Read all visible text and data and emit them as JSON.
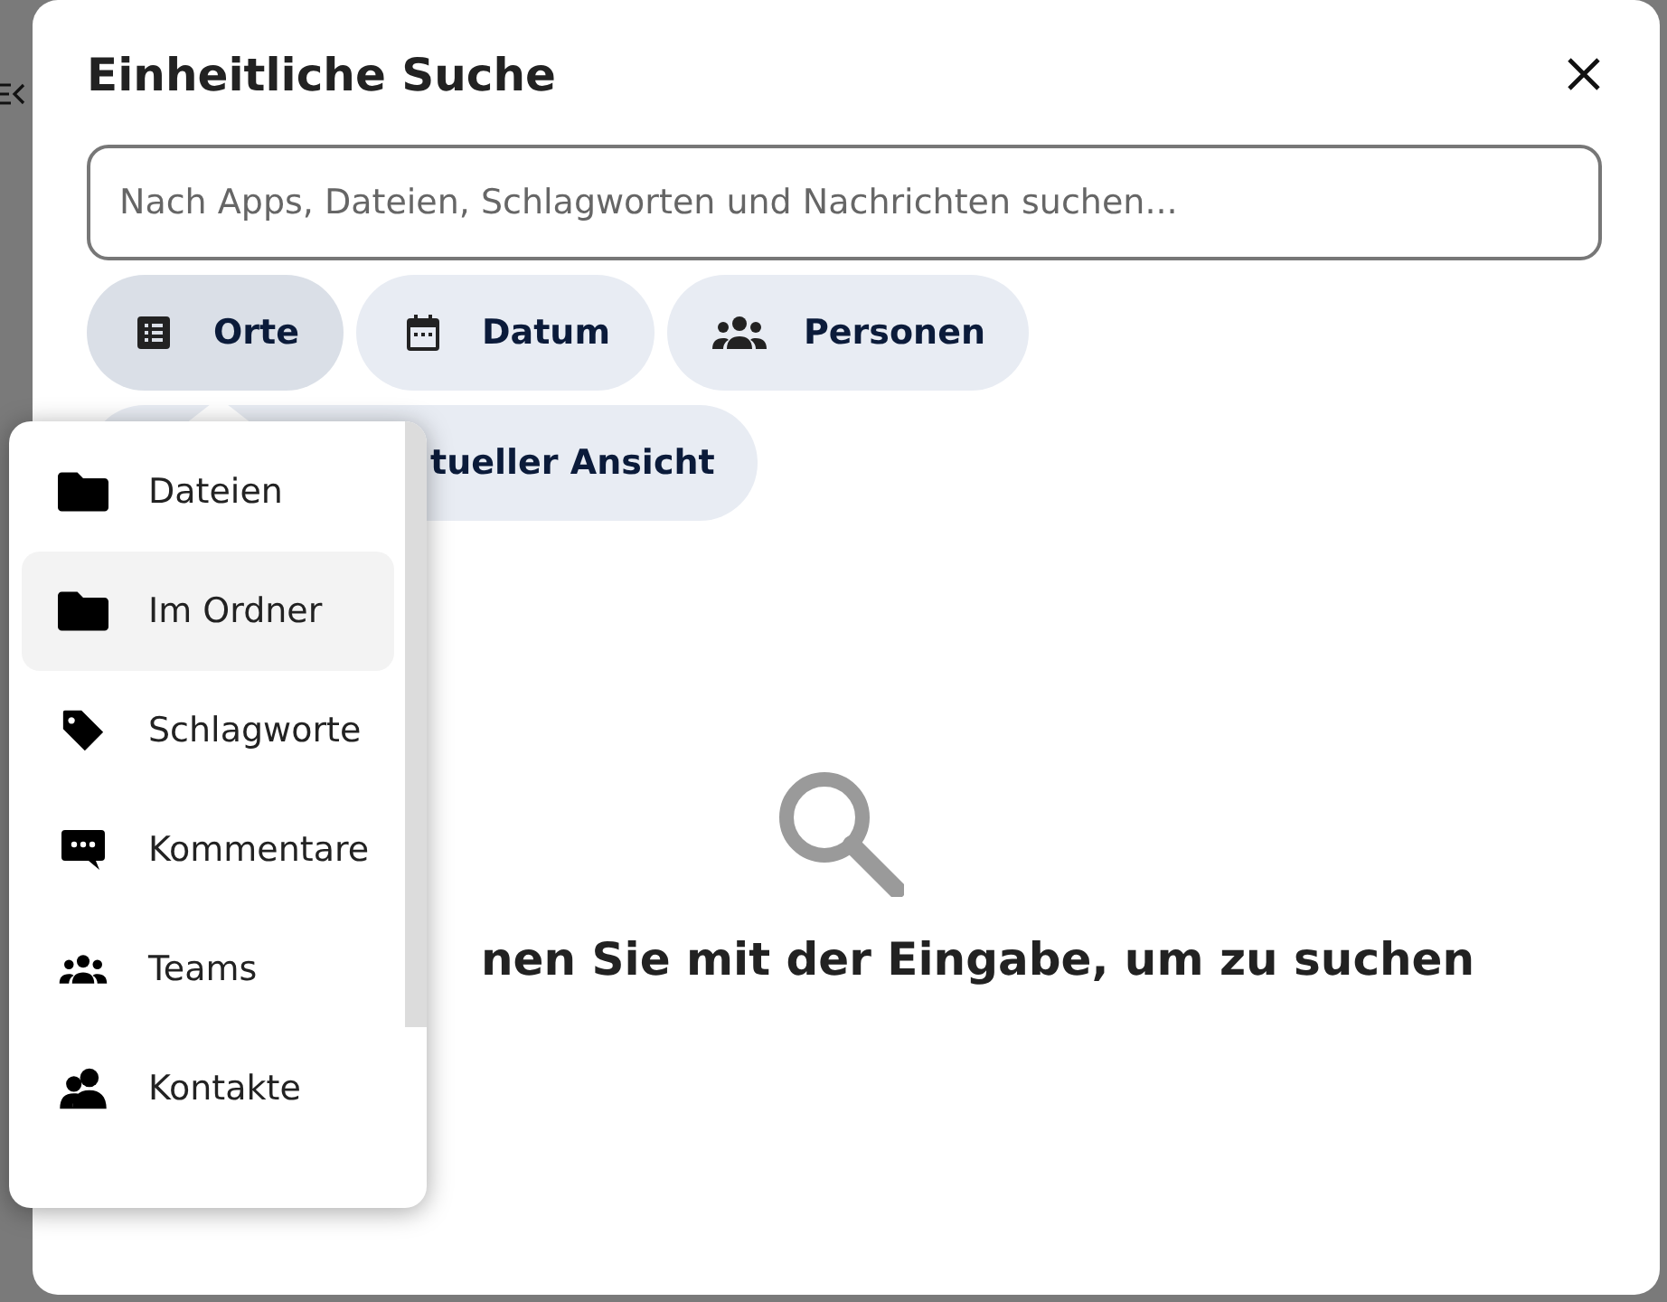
{
  "dialog": {
    "title": "Einheitliche Suche"
  },
  "search": {
    "placeholder": "Nach Apps, Dateien, Schlagworten und Nachrichten suchen..."
  },
  "filters": [
    {
      "kind": "places",
      "label": "Orte",
      "selected": true
    },
    {
      "kind": "date",
      "label": "Datum",
      "selected": false
    },
    {
      "kind": "people",
      "label": "Personen",
      "selected": false
    },
    {
      "kind": "view",
      "label": "tueller Ansicht",
      "selected": false
    }
  ],
  "places_menu": {
    "items": [
      {
        "kind": "folder",
        "label": "Dateien",
        "selected": false
      },
      {
        "kind": "folder",
        "label": "Im Ordner",
        "selected": true
      },
      {
        "kind": "tag",
        "label": "Schlagworte",
        "selected": false
      },
      {
        "kind": "comment",
        "label": "Kommentare",
        "selected": false
      },
      {
        "kind": "team",
        "label": "Teams",
        "selected": false
      },
      {
        "kind": "contact",
        "label": "Kontakte",
        "selected": false
      }
    ]
  },
  "empty_state": {
    "message": "nen Sie mit der Eingabe, um zu suchen"
  }
}
